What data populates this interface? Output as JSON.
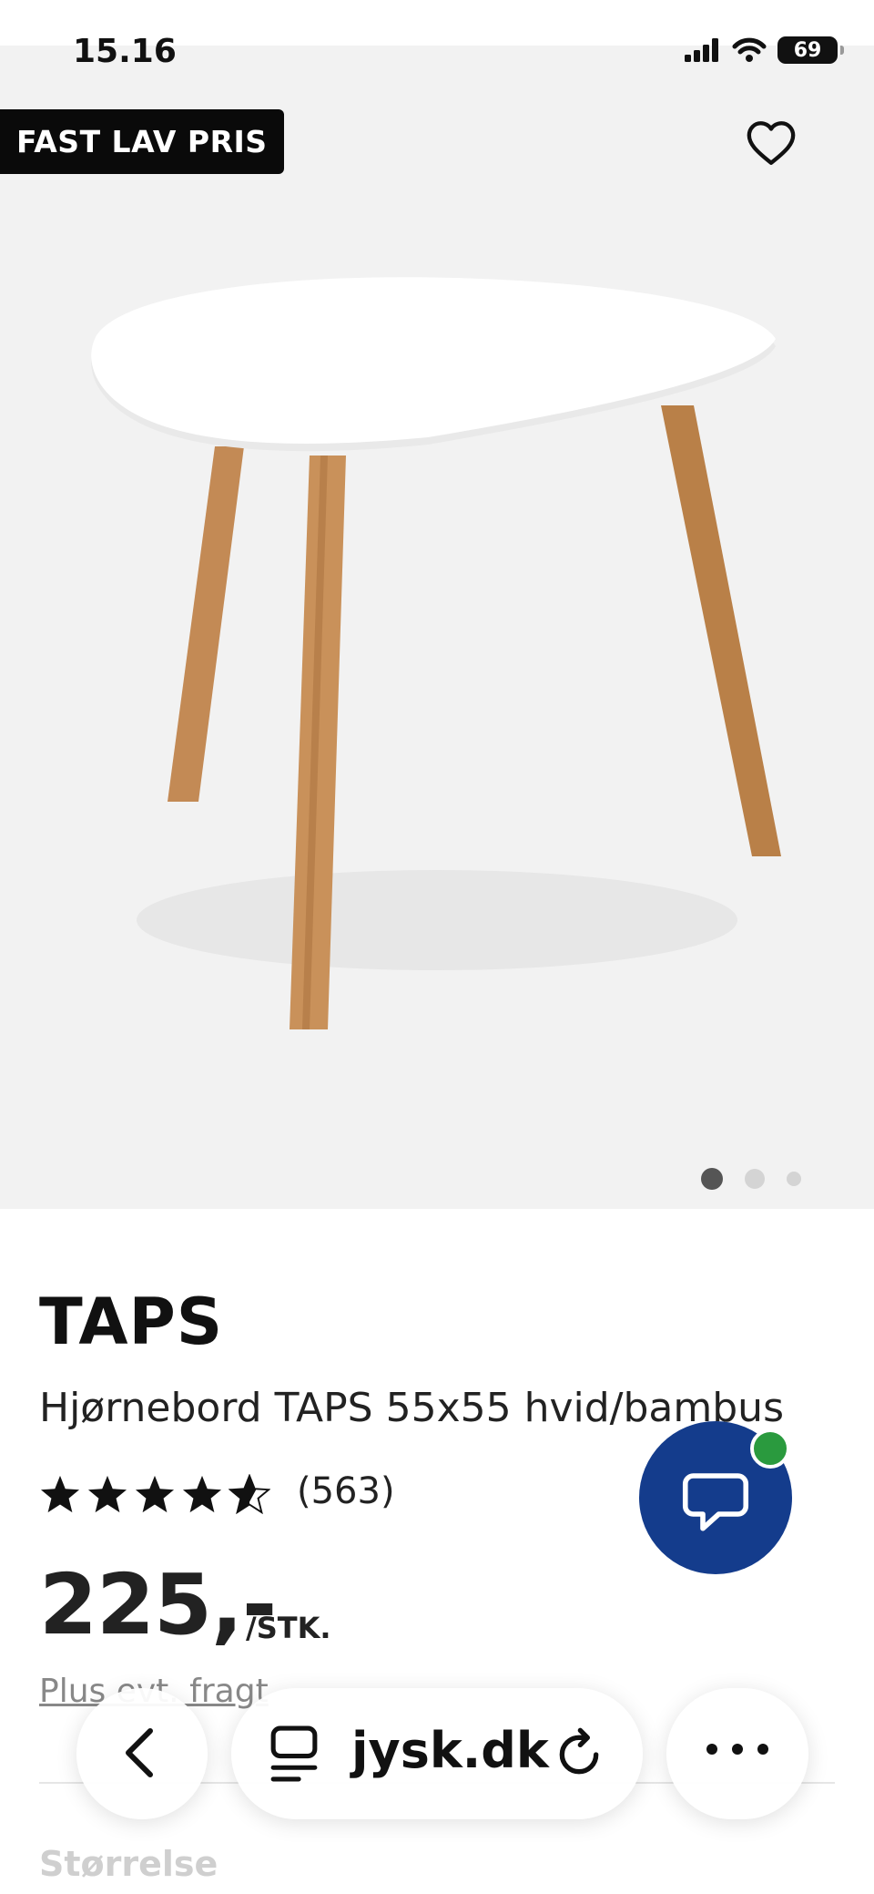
{
  "status_bar": {
    "time": "15.16",
    "battery": "69"
  },
  "product": {
    "badge": "FAST LAV PRIS",
    "brand": "TAPS",
    "title": "Hjørnebord TAPS 55x55 hvid/bambus",
    "rating": 4.5,
    "rating_count": "(563)",
    "price": "225,-",
    "unit": "/STK.",
    "shipping": "Plus evt. fragt",
    "size_label": "Størrelse"
  },
  "gallery": {
    "active_index": 0,
    "total": 3
  },
  "browser": {
    "url": "jysk.dk"
  },
  "colors": {
    "chat_button": "#143c8c",
    "chat_online": "#2a9a3e",
    "badge_bg": "#0a0a0a"
  }
}
